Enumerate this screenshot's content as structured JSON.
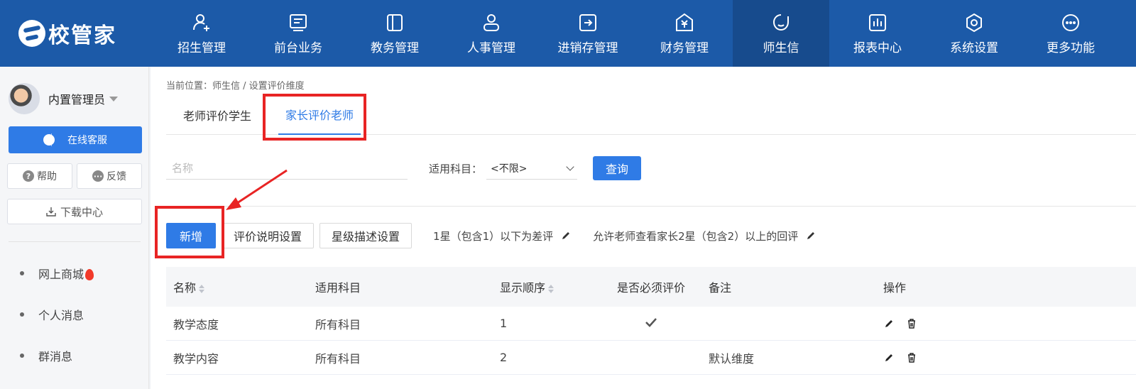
{
  "brand": {
    "name": "校管家"
  },
  "nav": {
    "items": [
      {
        "label": "招生管理",
        "icon": "user-add-icon"
      },
      {
        "label": "前台业务",
        "icon": "monitor-icon"
      },
      {
        "label": "教务管理",
        "icon": "book-icon"
      },
      {
        "label": "人事管理",
        "icon": "person-icon"
      },
      {
        "label": "进销存管理",
        "icon": "inventory-icon"
      },
      {
        "label": "财务管理",
        "icon": "yuan-icon"
      },
      {
        "label": "师生信",
        "icon": "chat-icon",
        "active": true
      },
      {
        "label": "报表中心",
        "icon": "report-icon"
      },
      {
        "label": "系统设置",
        "icon": "settings-icon"
      },
      {
        "label": "更多功能",
        "icon": "more-icon"
      }
    ]
  },
  "sidebar": {
    "user_name": "内置管理员",
    "service_label": "在线客服",
    "help_label": "帮助",
    "feedback_label": "反馈",
    "download_label": "下载中心",
    "links": [
      "网上商城",
      "个人消息",
      "群消息"
    ]
  },
  "main": {
    "breadcrumb": "当前位置：师生信 / 设置评价维度",
    "tabs": [
      {
        "label": "老师评价学生",
        "active": false
      },
      {
        "label": "家长评价老师",
        "active": true
      }
    ],
    "filter": {
      "name_placeholder": "名称",
      "subject_label": "适用科目：",
      "subject_value": "<不限>",
      "query_label": "查询"
    },
    "toolbar": {
      "add_label": "新增",
      "eval_desc_label": "评价说明设置",
      "star_desc_label": "星级描述设置",
      "rule1": "1星（包含1）以下为差评",
      "rule2": "允许老师查看家长2星（包含2）以上的回评"
    },
    "table": {
      "headers": [
        "名称",
        "适用科目",
        "显示顺序",
        "是否必须评价",
        "备注",
        "操作"
      ],
      "rows": [
        {
          "name": "教学态度",
          "subject": "所有科目",
          "order": "1",
          "required": true,
          "note": ""
        },
        {
          "name": "教学内容",
          "subject": "所有科目",
          "order": "2",
          "required": false,
          "note": "默认维度"
        }
      ]
    }
  },
  "colors": {
    "nav_bg": "#1c5aa8",
    "accent": "#2f7be6",
    "highlight": "#e82424"
  }
}
